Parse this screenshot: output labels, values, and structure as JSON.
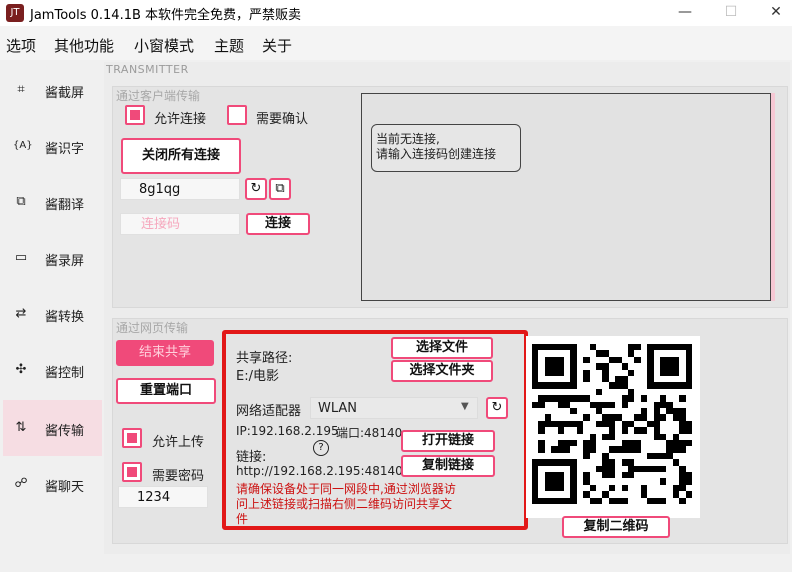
{
  "window": {
    "title": "JamTools 0.14.1B 本软件完全免费，严禁贩卖",
    "icon_text": "JT",
    "controls": {
      "minimize": "—",
      "maximize": "☐",
      "close": "✕"
    }
  },
  "menu": [
    "选项",
    "其他功能",
    "小窗模式",
    "主题",
    "关于"
  ],
  "sidebar": {
    "items": [
      {
        "label": "酱截屏",
        "icon": "crop-icon",
        "glyph": "⌗"
      },
      {
        "label": "酱识字",
        "icon": "ocr-icon",
        "glyph": "{A}"
      },
      {
        "label": "酱翻译",
        "icon": "translate-icon",
        "glyph": "⧉"
      },
      {
        "label": "酱录屏",
        "icon": "record-icon",
        "glyph": "▭"
      },
      {
        "label": "酱转换",
        "icon": "convert-icon",
        "glyph": "⇄"
      },
      {
        "label": "酱控制",
        "icon": "control-icon",
        "glyph": "✣"
      },
      {
        "label": "酱传输",
        "icon": "transfer-icon",
        "glyph": "⇅"
      },
      {
        "label": "酱聊天",
        "icon": "chat-icon",
        "glyph": "☍"
      }
    ],
    "active_index": 6
  },
  "transmitter": {
    "section_label": "TRANSMITTER",
    "client": {
      "title": "通过客户端传输",
      "allow_connect_label": "允许连接",
      "allow_connect_checked": true,
      "need_confirm_label": "需要确认",
      "need_confirm_checked": false,
      "close_all_button": "关闭所有连接",
      "code_value": "8g1qg",
      "refresh_icon": "↻",
      "copy_icon": "⧉",
      "connect_placeholder": "连接码",
      "connect_button": "连接",
      "status_message_line1": "当前无连接,",
      "status_message_line2": "请输入连接码创建连接"
    },
    "web": {
      "title": "通过网页传输",
      "end_share_button": "结束共享",
      "reset_port_button": "重置端口",
      "allow_upload_label": "允许上传",
      "allow_upload_checked": true,
      "need_password_label": "需要密码",
      "need_password_checked": true,
      "password_value": "1234",
      "share_path_label": "共享路径:",
      "share_path_value": "E:/电影",
      "select_file_button": "选择文件",
      "select_folder_button": "选择文件夹",
      "adapter_label": "网络适配器",
      "adapter_value": "WLAN",
      "ip_text": "IP:192.168.2.195",
      "port_text": "端口:48140",
      "open_link_button": "打开链接",
      "link_label": "链接:",
      "help_icon": "?",
      "link_value": "http://192.168.2.195:48140",
      "copy_link_button": "复制链接",
      "notice_line1": "请确保设备处于同一网段中,通过浏览器访",
      "notice_line2": "问上述链接或扫描右侧二维码访问共享文",
      "notice_line3": "件",
      "copy_qr_button": "复制二维码"
    }
  }
}
